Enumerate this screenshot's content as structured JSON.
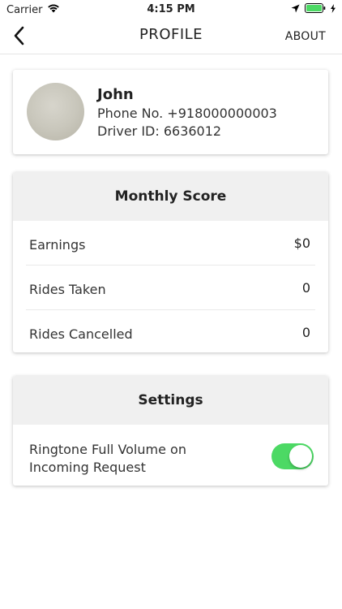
{
  "status_bar": {
    "carrier": "Carrier",
    "time": "4:15 PM"
  },
  "nav": {
    "title": "PROFILE",
    "about_label": "ABOUT"
  },
  "profile": {
    "name": "John",
    "phone": "Phone No. +918000000003",
    "driver_id": "Driver ID: 6636012"
  },
  "monthly_score": {
    "title": "Monthly Score",
    "rows": [
      {
        "label": "Earnings",
        "value": "$0"
      },
      {
        "label": "Rides Taken",
        "value": "0"
      },
      {
        "label": "Rides Cancelled",
        "value": "0"
      }
    ]
  },
  "settings": {
    "title": "Settings",
    "ringtone_label": "Ringtone Full Volume on Incoming Request",
    "ringtone_enabled": true
  },
  "colors": {
    "toggle_on": "#4cd964",
    "header_bg": "#f0f0f0"
  }
}
